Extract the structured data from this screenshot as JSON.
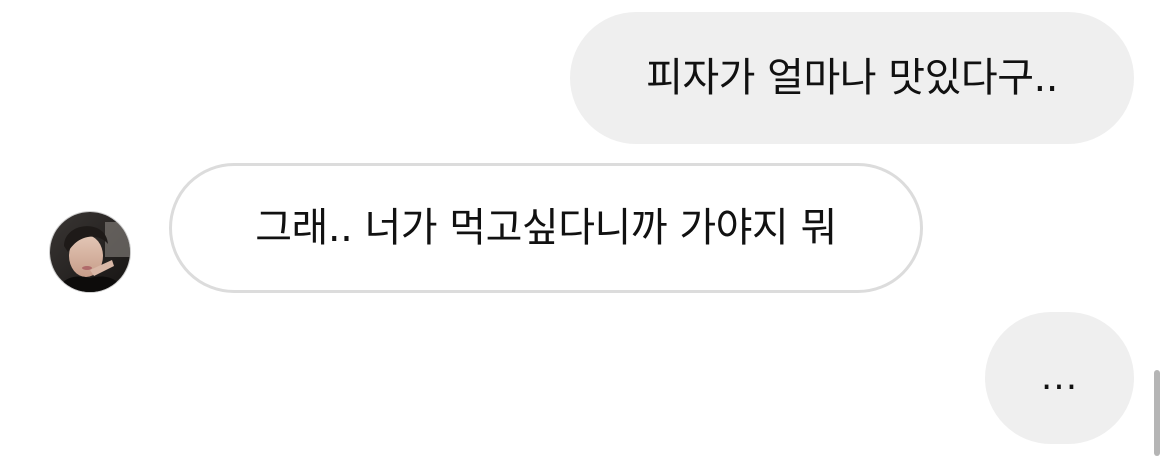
{
  "messages": [
    {
      "direction": "outgoing",
      "text": "피자가 얼마나 맛있다구.."
    },
    {
      "direction": "incoming",
      "text": "그래.. 너가 먹고싶다니까 가야지 뭐"
    },
    {
      "direction": "outgoing",
      "text": "..."
    }
  ],
  "contact": {
    "avatar_icon": "profile-photo"
  },
  "colors": {
    "outgoing_bubble": "#efefef",
    "incoming_bubble": "#ffffff",
    "incoming_border": "#dcdcdc",
    "text": "#111111"
  }
}
